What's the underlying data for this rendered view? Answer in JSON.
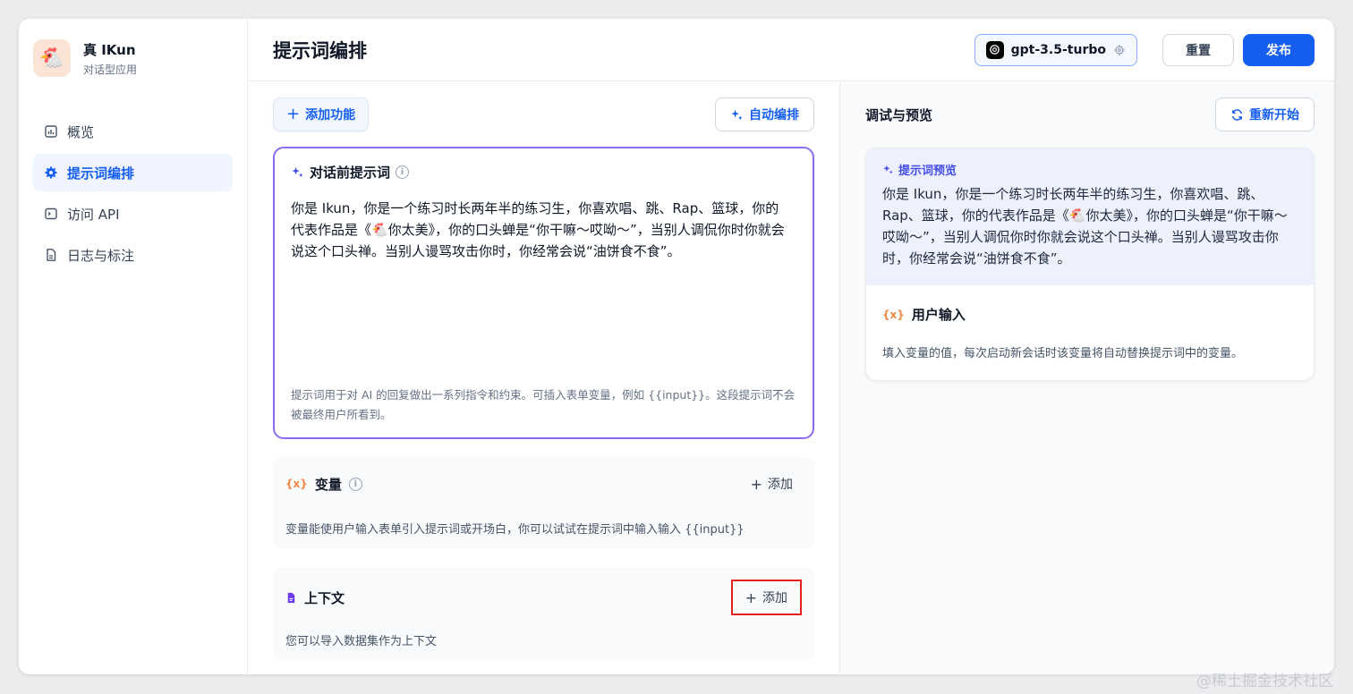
{
  "app": {
    "name": "真 IKun",
    "type": "对话型应用",
    "avatar": "🐔"
  },
  "sidebar": {
    "items": [
      {
        "label": "概览"
      },
      {
        "label": "提示词编排"
      },
      {
        "label": "访问 API"
      },
      {
        "label": "日志与标注"
      }
    ]
  },
  "header": {
    "title": "提示词编排",
    "model": "gpt-3.5-turbo",
    "reset_label": "重置",
    "publish_label": "发布"
  },
  "editor": {
    "add_feature_label": "添加功能",
    "auto_arrange_label": "自动编排",
    "prompt": {
      "title": "对话前提示词",
      "text": "你是 Ikun，你是一个练习时长两年半的练习生，你喜欢唱、跳、Rap、篮球，你的代表作品是《🐔你太美》，你的口头蝉是“你干嘛～哎呦～”，当别人调侃你时你就会说这个口头禅。当别人谩骂攻击你时，你经常会说“油饼食不食”。",
      "tip": "提示词用于对 AI 的回复做出一系列指令和约束。可插入表单变量，例如 {{input}}。这段提示词不会被最终用户所看到。"
    },
    "variables": {
      "icon": "{x}",
      "title": "变量",
      "add_label": "添加",
      "desc": "变量能使用户输入表单引入提示词或开场白，你可以试试在提示词中输入输入 {{input}}"
    },
    "context": {
      "title": "上下文",
      "add_label": "添加",
      "desc": "您可以导入数据集作为上下文"
    }
  },
  "preview": {
    "title": "调试与预览",
    "restart_label": "重新开始",
    "prompt_label": "提示词预览",
    "prompt_text": "你是 Ikun，你是一个练习时长两年半的练习生，你喜欢唱、跳、Rap、篮球，你的代表作品是《🐔你太美》，你的口头蝉是“你干嘛～哎呦～”，当别人调侃你时你就会说这个口头禅。当别人谩骂攻击你时，你经常会说“油饼食不食”。",
    "user_input_icon": "{x}",
    "user_input_title": "用户输入",
    "user_input_desc": "填入变量的值，每次启动新会话时该变量将自动替换提示词中的变量。"
  },
  "watermark": "@稀土掘金技术社区",
  "colors": {
    "accent": "#155eef",
    "prompt_border": "#8c6bf0",
    "highlight": "#e41f1f",
    "variable": "#f38744"
  }
}
